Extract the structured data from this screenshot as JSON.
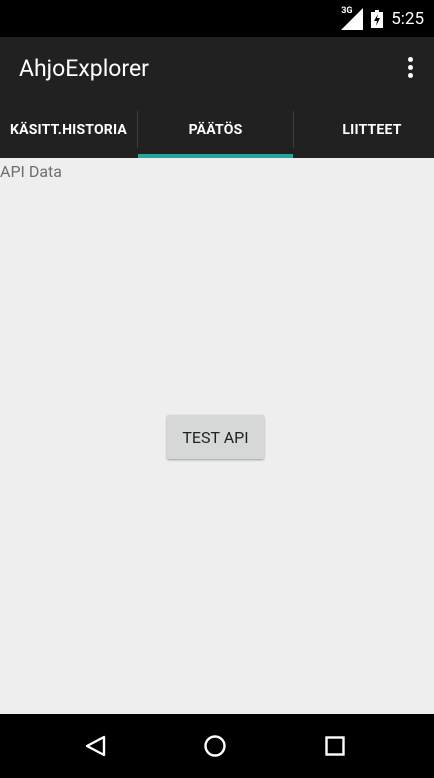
{
  "status_bar": {
    "network_label": "3G",
    "time": "5:25",
    "icons": [
      "signal-icon",
      "battery-charging-icon"
    ]
  },
  "app_bar": {
    "title": "AhjoExplorer",
    "overflow_icon": "more-vert-icon"
  },
  "tabs": [
    {
      "label": "KÄSITT.HISTORIA",
      "selected": false
    },
    {
      "label": "PÄÄTÖS",
      "selected": true
    },
    {
      "label": "LIITTEET",
      "selected": false
    }
  ],
  "content": {
    "api_data_text": "API Data",
    "test_button_label": "TEST API"
  },
  "nav_bar": {
    "icons": [
      "back-icon",
      "home-icon",
      "recents-icon"
    ]
  },
  "colors": {
    "status_bar": "#000000",
    "app_bar": "#212121",
    "tab_indicator": "#26a69a",
    "content_bg": "#eeeeee",
    "button_bg": "#d6d7d7"
  }
}
